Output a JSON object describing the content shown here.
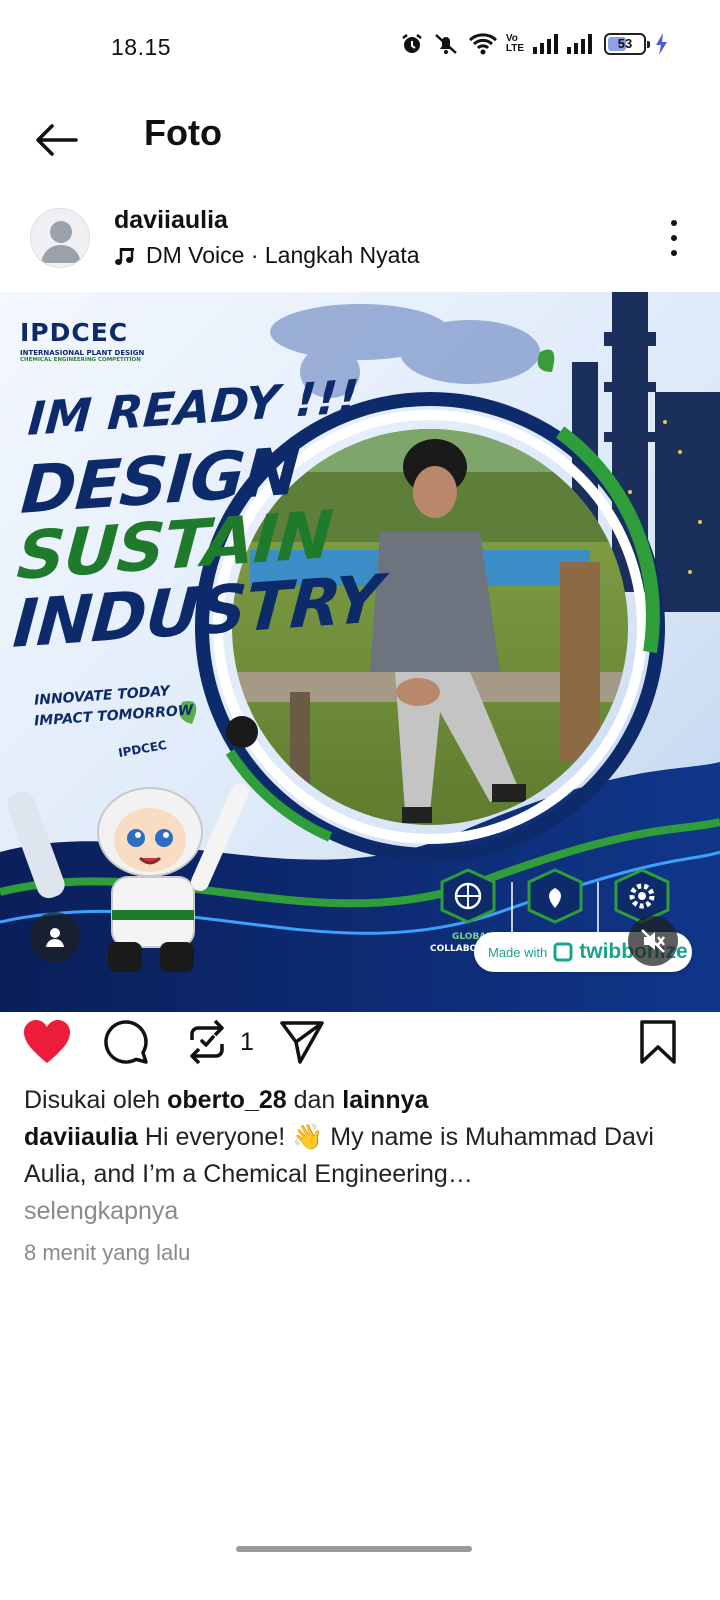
{
  "status_bar": {
    "time": "18.15",
    "battery_level": "53",
    "battery_percent": 53,
    "battery_color": "#8ea0e8",
    "charging_color": "#4a5fd8",
    "icons": [
      "alarm-icon",
      "mute-icon",
      "wifi-icon",
      "volte-icon",
      "signal-icon",
      "signal-icon",
      "battery-icon",
      "charging-icon"
    ],
    "volte_top": "Vo",
    "volte_bottom": "LTE"
  },
  "header": {
    "back_icon": "arrow-left-icon",
    "title": "Foto"
  },
  "post": {
    "username": "daviiaulia",
    "music": {
      "icon": "music-note-icon",
      "label": "DM Voice · Langkah Nyata"
    },
    "more_icon": "more-vertical-icon",
    "image": {
      "logo": "IPDCEC",
      "logo_subtitle": "INTERNASIONAL PLANT DESIGN",
      "logo_subtitle_2": "CHEMICAL ENGINEERING COMPETITION",
      "headline_1": "IM READY !!!",
      "headline_2": "DESIGN",
      "headline_3": "SUSTAIN",
      "headline_4": "INDUSTRY",
      "tagline_1": "INNOVATE TODAY",
      "tagline_2": "IMPACT TOMORROW",
      "mascot_badge": "IPDCEC",
      "feature_1": "GLOBAL",
      "feature_1b": "COLLABO",
      "watermark_made": "Made with",
      "watermark_brand": "twibbonize",
      "accent_blue": "#0d2a6b",
      "accent_green": "#1f7a2c"
    },
    "actions": {
      "like_icon": "heart-filled-icon",
      "comment_icon": "comment-icon",
      "repost_icon": "repost-icon",
      "repost_count": "1",
      "share_icon": "send-icon",
      "save_icon": "bookmark-icon",
      "like_color": "#ed1c3a"
    },
    "likes": {
      "prefix": "Disukai oleh",
      "user": "oberto_28",
      "connector": "dan",
      "others": "lainnya"
    },
    "caption": {
      "username": "daviiaulia",
      "text": "Hi everyone! 👋 My name is Muhammad Davi Aulia, and I’m a Chemical Engineering…",
      "more": "selengkapnya"
    },
    "timestamp": "8 menit yang lalu"
  }
}
